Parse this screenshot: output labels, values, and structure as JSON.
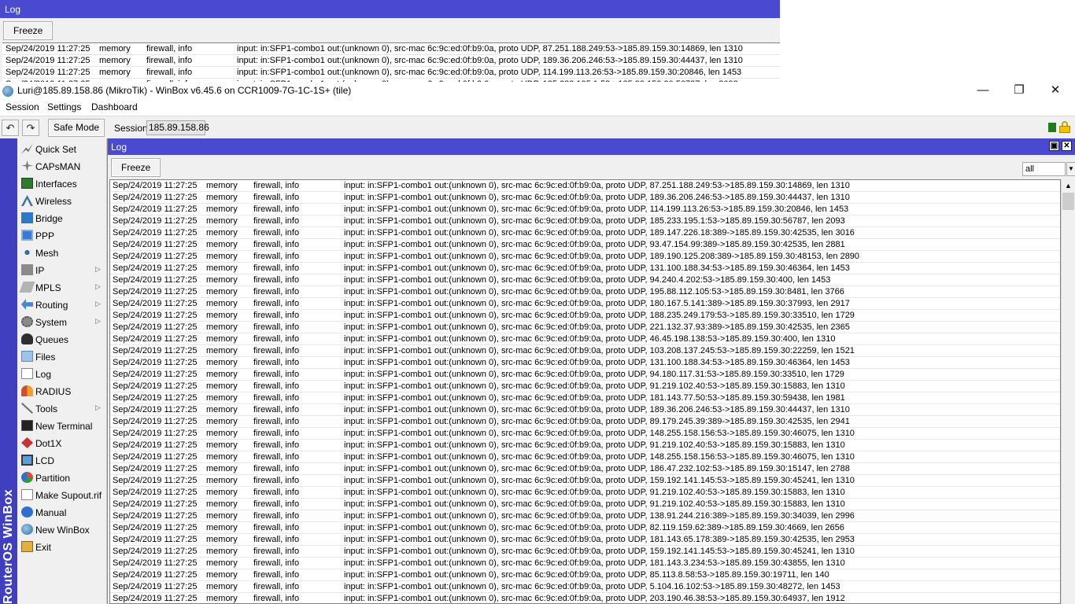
{
  "background_log": {
    "title": "Log",
    "freeze_label": "Freeze",
    "rows": [
      {
        "time": "Sep/24/2019 11:27:25",
        "buffer": "memory",
        "topics": "firewall, info",
        "message": "input: in:SFP1-combo1 out:(unknown 0), src-mac 6c:9c:ed:0f:b9:0a, proto UDP, 87.251.188.249:53->185.89.159.30:14869, len 1310"
      },
      {
        "time": "Sep/24/2019 11:27:25",
        "buffer": "memory",
        "topics": "firewall, info",
        "message": "input: in:SFP1-combo1 out:(unknown 0), src-mac 6c:9c:ed:0f:b9:0a, proto UDP, 189.36.206.246:53->185.89.159.30:44437, len 1310"
      },
      {
        "time": "Sep/24/2019 11:27:25",
        "buffer": "memory",
        "topics": "firewall, info",
        "message": "input: in:SFP1-combo1 out:(unknown 0), src-mac 6c:9c:ed:0f:b9:0a, proto UDP, 114.199.113.26:53->185.89.159.30:20846, len 1453"
      },
      {
        "time": "Sep/24/2019 11:27:25",
        "buffer": "memory",
        "topics": "firewall, info",
        "message": "input: in:SFP1-combo1 out:(unknown 0), src-mac 6c:9c:ed:0f:b9:0a, proto UDP, 185.233.195.1:53->185.89.159.30:56787, len 2093"
      }
    ]
  },
  "window": {
    "title": "Luri@185.89.158.86 (MikroTik) - WinBox v6.45.6 on CCR1009-7G-1C-1S+ (tile)",
    "minimize_glyph": "—",
    "maximize_glyph": "❐",
    "close_glyph": "✕"
  },
  "menu": {
    "session": "Session",
    "settings": "Settings",
    "dashboard": "Dashboard"
  },
  "toolbar": {
    "undo_glyph": "↶",
    "redo_glyph": "↷",
    "safe_mode": "Safe Mode",
    "session_label": "Session:",
    "session_value": "185.89.158.86",
    "status_color": "#1e7b1e"
  },
  "brand": "RouterOS WinBox",
  "sidebar": {
    "items": [
      {
        "label": "Quick Set",
        "icon": "quick-set-icon",
        "submenu": false
      },
      {
        "label": "CAPsMAN",
        "icon": "capsman-icon",
        "submenu": false
      },
      {
        "label": "Interfaces",
        "icon": "interfaces-icon",
        "submenu": false
      },
      {
        "label": "Wireless",
        "icon": "wireless-icon",
        "submenu": false
      },
      {
        "label": "Bridge",
        "icon": "bridge-icon",
        "submenu": false
      },
      {
        "label": "PPP",
        "icon": "ppp-icon",
        "submenu": false
      },
      {
        "label": "Mesh",
        "icon": "mesh-icon",
        "submenu": false
      },
      {
        "label": "IP",
        "icon": "ip-icon",
        "submenu": true
      },
      {
        "label": "MPLS",
        "icon": "mpls-icon",
        "submenu": true
      },
      {
        "label": "Routing",
        "icon": "routing-icon",
        "submenu": true
      },
      {
        "label": "System",
        "icon": "system-gear-icon",
        "submenu": true
      },
      {
        "label": "Queues",
        "icon": "queues-icon",
        "submenu": false
      },
      {
        "label": "Files",
        "icon": "files-icon",
        "submenu": false
      },
      {
        "label": "Log",
        "icon": "log-icon",
        "submenu": false
      },
      {
        "label": "RADIUS",
        "icon": "radius-icon",
        "submenu": false
      },
      {
        "label": "Tools",
        "icon": "tools-icon",
        "submenu": true
      },
      {
        "label": "New Terminal",
        "icon": "terminal-icon",
        "submenu": false
      },
      {
        "label": "Dot1X",
        "icon": "dot1x-icon",
        "submenu": false
      },
      {
        "label": "LCD",
        "icon": "lcd-icon",
        "submenu": false
      },
      {
        "label": "Partition",
        "icon": "partition-icon",
        "submenu": false
      },
      {
        "label": "Make Supout.rif",
        "icon": "supout-icon",
        "submenu": false
      },
      {
        "label": "Manual",
        "icon": "manual-icon",
        "submenu": false
      },
      {
        "label": "New WinBox",
        "icon": "winbox-icon",
        "submenu": false
      },
      {
        "label": "Exit",
        "icon": "exit-icon",
        "submenu": false
      }
    ],
    "submenu_glyph": "▷"
  },
  "log": {
    "title": "Log",
    "restore_glyph": "▣",
    "close_glyph": "✕",
    "freeze_label": "Freeze",
    "filter_value": "all",
    "filter_arrow": "▼",
    "scroll_up_glyph": "▲",
    "rows": [
      {
        "time": "Sep/24/2019 11:27:25",
        "buffer": "memory",
        "topics": "firewall, info",
        "message": "input: in:SFP1-combo1 out:(unknown 0), src-mac 6c:9c:ed:0f:b9:0a, proto UDP, 87.251.188.249:53->185.89.159.30:14869, len 1310"
      },
      {
        "time": "Sep/24/2019 11:27:25",
        "buffer": "memory",
        "topics": "firewall, info",
        "message": "input: in:SFP1-combo1 out:(unknown 0), src-mac 6c:9c:ed:0f:b9:0a, proto UDP, 189.36.206.246:53->185.89.159.30:44437, len 1310"
      },
      {
        "time": "Sep/24/2019 11:27:25",
        "buffer": "memory",
        "topics": "firewall, info",
        "message": "input: in:SFP1-combo1 out:(unknown 0), src-mac 6c:9c:ed:0f:b9:0a, proto UDP, 114.199.113.26:53->185.89.159.30:20846, len 1453"
      },
      {
        "time": "Sep/24/2019 11:27:25",
        "buffer": "memory",
        "topics": "firewall, info",
        "message": "input: in:SFP1-combo1 out:(unknown 0), src-mac 6c:9c:ed:0f:b9:0a, proto UDP, 185.233.195.1:53->185.89.159.30:56787, len 2093"
      },
      {
        "time": "Sep/24/2019 11:27:25",
        "buffer": "memory",
        "topics": "firewall, info",
        "message": "input: in:SFP1-combo1 out:(unknown 0), src-mac 6c:9c:ed:0f:b9:0a, proto UDP, 189.147.226.18:389->185.89.159.30:42535, len 3016"
      },
      {
        "time": "Sep/24/2019 11:27:25",
        "buffer": "memory",
        "topics": "firewall, info",
        "message": "input: in:SFP1-combo1 out:(unknown 0), src-mac 6c:9c:ed:0f:b9:0a, proto UDP, 93.47.154.99:389->185.89.159.30:42535, len 2881"
      },
      {
        "time": "Sep/24/2019 11:27:25",
        "buffer": "memory",
        "topics": "firewall, info",
        "message": "input: in:SFP1-combo1 out:(unknown 0), src-mac 6c:9c:ed:0f:b9:0a, proto UDP, 189.190.125.208:389->185.89.159.30:48153, len 2890"
      },
      {
        "time": "Sep/24/2019 11:27:25",
        "buffer": "memory",
        "topics": "firewall, info",
        "message": "input: in:SFP1-combo1 out:(unknown 0), src-mac 6c:9c:ed:0f:b9:0a, proto UDP, 131.100.188.34:53->185.89.159.30:46364, len 1453"
      },
      {
        "time": "Sep/24/2019 11:27:25",
        "buffer": "memory",
        "topics": "firewall, info",
        "message": "input: in:SFP1-combo1 out:(unknown 0), src-mac 6c:9c:ed:0f:b9:0a, proto UDP, 94.240.4.202:53->185.89.159.30:400, len 1453"
      },
      {
        "time": "Sep/24/2019 11:27:25",
        "buffer": "memory",
        "topics": "firewall, info",
        "message": "input: in:SFP1-combo1 out:(unknown 0), src-mac 6c:9c:ed:0f:b9:0a, proto UDP, 195.88.112.105:53->185.89.159.30:8481, len 3766"
      },
      {
        "time": "Sep/24/2019 11:27:25",
        "buffer": "memory",
        "topics": "firewall, info",
        "message": "input: in:SFP1-combo1 out:(unknown 0), src-mac 6c:9c:ed:0f:b9:0a, proto UDP, 180.167.5.141:389->185.89.159.30:37993, len 2917"
      },
      {
        "time": "Sep/24/2019 11:27:25",
        "buffer": "memory",
        "topics": "firewall, info",
        "message": "input: in:SFP1-combo1 out:(unknown 0), src-mac 6c:9c:ed:0f:b9:0a, proto UDP, 188.235.249.179:53->185.89.159.30:33510, len 1729"
      },
      {
        "time": "Sep/24/2019 11:27:25",
        "buffer": "memory",
        "topics": "firewall, info",
        "message": "input: in:SFP1-combo1 out:(unknown 0), src-mac 6c:9c:ed:0f:b9:0a, proto UDP, 221.132.37.93:389->185.89.159.30:42535, len 2365"
      },
      {
        "time": "Sep/24/2019 11:27:25",
        "buffer": "memory",
        "topics": "firewall, info",
        "message": "input: in:SFP1-combo1 out:(unknown 0), src-mac 6c:9c:ed:0f:b9:0a, proto UDP, 46.45.198.138:53->185.89.159.30:400, len 1310"
      },
      {
        "time": "Sep/24/2019 11:27:25",
        "buffer": "memory",
        "topics": "firewall, info",
        "message": "input: in:SFP1-combo1 out:(unknown 0), src-mac 6c:9c:ed:0f:b9:0a, proto UDP, 103.208.137.245:53->185.89.159.30:22259, len 1521"
      },
      {
        "time": "Sep/24/2019 11:27:25",
        "buffer": "memory",
        "topics": "firewall, info",
        "message": "input: in:SFP1-combo1 out:(unknown 0), src-mac 6c:9c:ed:0f:b9:0a, proto UDP, 131.100.188.34:53->185.89.159.30:46364, len 1453"
      },
      {
        "time": "Sep/24/2019 11:27:25",
        "buffer": "memory",
        "topics": "firewall, info",
        "message": "input: in:SFP1-combo1 out:(unknown 0), src-mac 6c:9c:ed:0f:b9:0a, proto UDP, 94.180.117.31:53->185.89.159.30:33510, len 1729"
      },
      {
        "time": "Sep/24/2019 11:27:25",
        "buffer": "memory",
        "topics": "firewall, info",
        "message": "input: in:SFP1-combo1 out:(unknown 0), src-mac 6c:9c:ed:0f:b9:0a, proto UDP, 91.219.102.40:53->185.89.159.30:15883, len 1310"
      },
      {
        "time": "Sep/24/2019 11:27:25",
        "buffer": "memory",
        "topics": "firewall, info",
        "message": "input: in:SFP1-combo1 out:(unknown 0), src-mac 6c:9c:ed:0f:b9:0a, proto UDP, 181.143.77.50:53->185.89.159.30:59438, len 1981"
      },
      {
        "time": "Sep/24/2019 11:27:25",
        "buffer": "memory",
        "topics": "firewall, info",
        "message": "input: in:SFP1-combo1 out:(unknown 0), src-mac 6c:9c:ed:0f:b9:0a, proto UDP, 189.36.206.246:53->185.89.159.30:44437, len 1310"
      },
      {
        "time": "Sep/24/2019 11:27:25",
        "buffer": "memory",
        "topics": "firewall, info",
        "message": "input: in:SFP1-combo1 out:(unknown 0), src-mac 6c:9c:ed:0f:b9:0a, proto UDP, 89.179.245.39:389->185.89.159.30:42535, len 2941"
      },
      {
        "time": "Sep/24/2019 11:27:25",
        "buffer": "memory",
        "topics": "firewall, info",
        "message": "input: in:SFP1-combo1 out:(unknown 0), src-mac 6c:9c:ed:0f:b9:0a, proto UDP, 148.255.158.156:53->185.89.159.30:46075, len 1310"
      },
      {
        "time": "Sep/24/2019 11:27:25",
        "buffer": "memory",
        "topics": "firewall, info",
        "message": "input: in:SFP1-combo1 out:(unknown 0), src-mac 6c:9c:ed:0f:b9:0a, proto UDP, 91.219.102.40:53->185.89.159.30:15883, len 1310"
      },
      {
        "time": "Sep/24/2019 11:27:25",
        "buffer": "memory",
        "topics": "firewall, info",
        "message": "input: in:SFP1-combo1 out:(unknown 0), src-mac 6c:9c:ed:0f:b9:0a, proto UDP, 148.255.158.156:53->185.89.159.30:46075, len 1310"
      },
      {
        "time": "Sep/24/2019 11:27:25",
        "buffer": "memory",
        "topics": "firewall, info",
        "message": "input: in:SFP1-combo1 out:(unknown 0), src-mac 6c:9c:ed:0f:b9:0a, proto UDP, 186.47.232.102:53->185.89.159.30:15147, len 2788"
      },
      {
        "time": "Sep/24/2019 11:27:25",
        "buffer": "memory",
        "topics": "firewall, info",
        "message": "input: in:SFP1-combo1 out:(unknown 0), src-mac 6c:9c:ed:0f:b9:0a, proto UDP, 159.192.141.145:53->185.89.159.30:45241, len 1310"
      },
      {
        "time": "Sep/24/2019 11:27:25",
        "buffer": "memory",
        "topics": "firewall, info",
        "message": "input: in:SFP1-combo1 out:(unknown 0), src-mac 6c:9c:ed:0f:b9:0a, proto UDP, 91.219.102.40:53->185.89.159.30:15883, len 1310"
      },
      {
        "time": "Sep/24/2019 11:27:25",
        "buffer": "memory",
        "topics": "firewall, info",
        "message": "input: in:SFP1-combo1 out:(unknown 0), src-mac 6c:9c:ed:0f:b9:0a, proto UDP, 91.219.102.40:53->185.89.159.30:15883, len 1310"
      },
      {
        "time": "Sep/24/2019 11:27:25",
        "buffer": "memory",
        "topics": "firewall, info",
        "message": "input: in:SFP1-combo1 out:(unknown 0), src-mac 6c:9c:ed:0f:b9:0a, proto UDP, 138.91.244.216:389->185.89.159.30:34039, len 2996"
      },
      {
        "time": "Sep/24/2019 11:27:25",
        "buffer": "memory",
        "topics": "firewall, info",
        "message": "input: in:SFP1-combo1 out:(unknown 0), src-mac 6c:9c:ed:0f:b9:0a, proto UDP, 82.119.159.62:389->185.89.159.30:4669, len 2656"
      },
      {
        "time": "Sep/24/2019 11:27:25",
        "buffer": "memory",
        "topics": "firewall, info",
        "message": "input: in:SFP1-combo1 out:(unknown 0), src-mac 6c:9c:ed:0f:b9:0a, proto UDP, 181.143.65.178:389->185.89.159.30:42535, len 2953"
      },
      {
        "time": "Sep/24/2019 11:27:25",
        "buffer": "memory",
        "topics": "firewall, info",
        "message": "input: in:SFP1-combo1 out:(unknown 0), src-mac 6c:9c:ed:0f:b9:0a, proto UDP, 159.192.141.145:53->185.89.159.30:45241, len 1310"
      },
      {
        "time": "Sep/24/2019 11:27:25",
        "buffer": "memory",
        "topics": "firewall, info",
        "message": "input: in:SFP1-combo1 out:(unknown 0), src-mac 6c:9c:ed:0f:b9:0a, proto UDP, 181.143.3.234:53->185.89.159.30:43855, len 1310"
      },
      {
        "time": "Sep/24/2019 11:27:25",
        "buffer": "memory",
        "topics": "firewall, info",
        "message": "input: in:SFP1-combo1 out:(unknown 0), src-mac 6c:9c:ed:0f:b9:0a, proto UDP, 85.113.8.58:53->185.89.159.30:19711, len 140"
      },
      {
        "time": "Sep/24/2019 11:27:25",
        "buffer": "memory",
        "topics": "firewall, info",
        "message": "input: in:SFP1-combo1 out:(unknown 0), src-mac 6c:9c:ed:0f:b9:0a, proto UDP, 5.104.16.102:53->185.89.159.30:48272, len 1453"
      },
      {
        "time": "Sep/24/2019 11:27:25",
        "buffer": "memory",
        "topics": "firewall, info",
        "message": "input: in:SFP1-combo1 out:(unknown 0), src-mac 6c:9c:ed:0f:b9:0a, proto UDP, 203.190.46.38:53->185.89.159.30:64937, len 1912"
      }
    ]
  }
}
